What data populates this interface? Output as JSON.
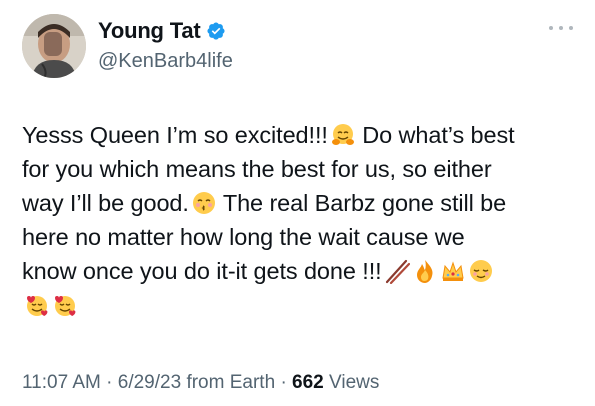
{
  "author": {
    "display_name": "Young Tat",
    "handle": "@KenBarb4life",
    "verified": true,
    "verified_color": "#1d9bf0"
  },
  "tweet": {
    "lines": [
      {
        "segments": [
          {
            "text": "Yesss Queen I’m so excited!!!"
          },
          {
            "emoji": "hugging-face"
          },
          {
            "text": " Do what’s best"
          }
        ]
      },
      {
        "segments": [
          {
            "text": "for you which means the best for us, so either"
          }
        ]
      },
      {
        "segments": [
          {
            "text": "way I’ll be good."
          },
          {
            "emoji": "kissing-face"
          },
          {
            "text": " The real Barbz gone still be"
          }
        ]
      },
      {
        "segments": [
          {
            "text": "here no matter how long the wait cause we"
          }
        ]
      },
      {
        "segments": [
          {
            "text": "know once you do it-it gets done !!!"
          },
          {
            "emoji": "chopsticks"
          },
          {
            "emoji": "fire"
          },
          {
            "emoji": "crown"
          },
          {
            "emoji": "relieved-face"
          }
        ]
      },
      {
        "segments": [
          {
            "emoji": "smiling-face-with-hearts"
          },
          {
            "emoji": "smiling-face-with-hearts"
          }
        ]
      }
    ]
  },
  "meta": {
    "time": "11:07 AM",
    "date": "6/29/23",
    "source": "from Earth",
    "sep": "·",
    "views_count": "662",
    "views_label": "Views"
  },
  "icons": {
    "verified": "verified-badge-icon",
    "more": "more-options-icon"
  }
}
